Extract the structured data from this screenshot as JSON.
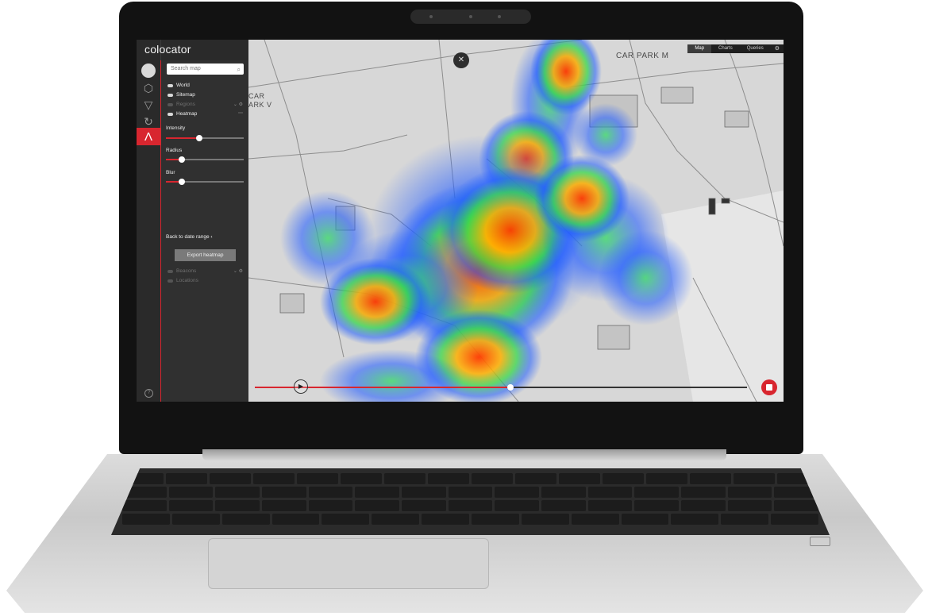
{
  "app": {
    "brand": "colocator"
  },
  "search": {
    "placeholder": "Search map"
  },
  "layers": [
    {
      "label": "World",
      "enabled": true
    },
    {
      "label": "Sitemap",
      "enabled": true
    },
    {
      "label": "Regions",
      "enabled": false
    },
    {
      "label": "Heatmap",
      "enabled": true
    },
    {
      "label": "Beacons",
      "enabled": false
    },
    {
      "label": "Locations",
      "enabled": false
    }
  ],
  "heatmap_controls": {
    "intensity": {
      "label": "Intensity",
      "level": 0.43
    },
    "radius": {
      "label": "Radius",
      "level": 0.2
    },
    "blur": {
      "label": "Blur",
      "level": 0.2
    }
  },
  "back_link": "Back to date range",
  "back_arrow": "‹",
  "export_button": "Export heatmap",
  "tabs": [
    {
      "label": "Map",
      "active": true
    },
    {
      "label": "Charts",
      "active": false
    },
    {
      "label": "Queries",
      "active": false
    }
  ],
  "map_labels": {
    "car_park_m": "CAR PARK M",
    "car_park_v_line1": "CAR",
    "car_park_v_line2": "ARK V"
  },
  "icons": {
    "search": "magnifier-icon",
    "close": "close-icon",
    "play": "play-icon",
    "stop": "stop-icon",
    "settings": "gear-icon",
    "help": "help-icon"
  },
  "glyphs": {
    "search": "⌕",
    "close": "✕",
    "play": "▶",
    "gear": "⚙",
    "help": "?",
    "layer_tools": "⌄ ⚙",
    "heatmap_menu": "⋯"
  },
  "timeline": {
    "progress": 0.52
  },
  "colors": {
    "accent": "#d8262f",
    "panel": "#303030",
    "rail": "#2a2a2a",
    "map_bg": "#d7d7d7"
  }
}
